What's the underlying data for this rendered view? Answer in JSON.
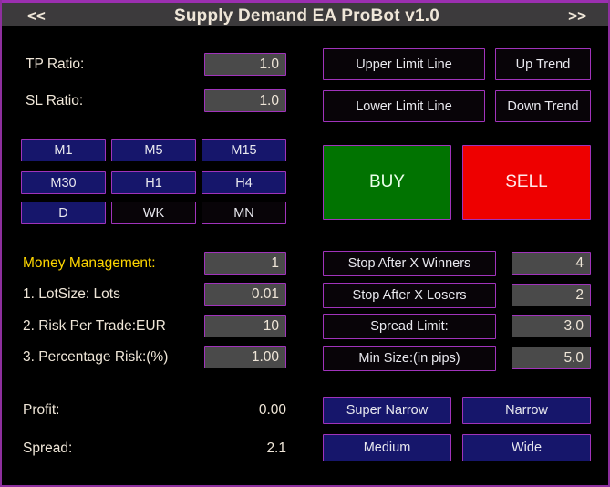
{
  "titlebar": {
    "prev_label": "<<",
    "title": "Supply Demand EA ProBot v1.0",
    "next_label": ">>"
  },
  "left_panel": {
    "ratios": [
      {
        "label": "TP Ratio:",
        "value": "1.0"
      },
      {
        "label": "SL Ratio:",
        "value": "1.0"
      }
    ],
    "timeframes": [
      {
        "label": "M1",
        "state": "active"
      },
      {
        "label": "M5",
        "state": "active"
      },
      {
        "label": "M15",
        "state": "active"
      },
      {
        "label": "M30",
        "state": "active"
      },
      {
        "label": "H1",
        "state": "active"
      },
      {
        "label": "H4",
        "state": "active"
      },
      {
        "label": "D",
        "state": "active"
      },
      {
        "label": "WK",
        "state": "inactive"
      },
      {
        "label": "MN",
        "state": "inactive"
      }
    ],
    "money_management": {
      "label": "Money Management:",
      "value": "1",
      "rows": [
        {
          "label": "1. LotSize: Lots",
          "value": "0.01"
        },
        {
          "label": "2. Risk Per Trade:EUR",
          "value": "10"
        },
        {
          "label": "3. Percentage Risk:(%)",
          "value": "1.00"
        }
      ]
    },
    "stats": [
      {
        "label": "Profit:",
        "value": "0.00"
      },
      {
        "label": "Spread:",
        "value": "2.1"
      }
    ]
  },
  "right_panel": {
    "line_buttons": [
      {
        "label": "Upper Limit Line"
      },
      {
        "label": "Up Trend"
      },
      {
        "label": "Lower Limit Line"
      },
      {
        "label": "Down Trend"
      }
    ],
    "trade_buttons": [
      {
        "label": "BUY"
      },
      {
        "label": "SELL"
      }
    ],
    "settings": [
      {
        "label": "Stop After X Winners",
        "value": "4"
      },
      {
        "label": "Stop After X Losers",
        "value": "2"
      },
      {
        "label": "Spread Limit:",
        "value": "3.0"
      },
      {
        "label": "Min Size:(in pips)",
        "value": "5.0"
      }
    ],
    "size_buttons": [
      {
        "label": "Super Narrow"
      },
      {
        "label": "Narrow"
      },
      {
        "label": "Medium"
      },
      {
        "label": "Wide"
      }
    ]
  },
  "colors": {
    "border_purple": "#a033bb",
    "navy": "#16166b",
    "buy_green": "#017301",
    "sell_red": "#ee0000",
    "gold": "#ffd700",
    "field_gray": "#4a4a4a",
    "titlebar_gray": "#3c3a3c"
  }
}
